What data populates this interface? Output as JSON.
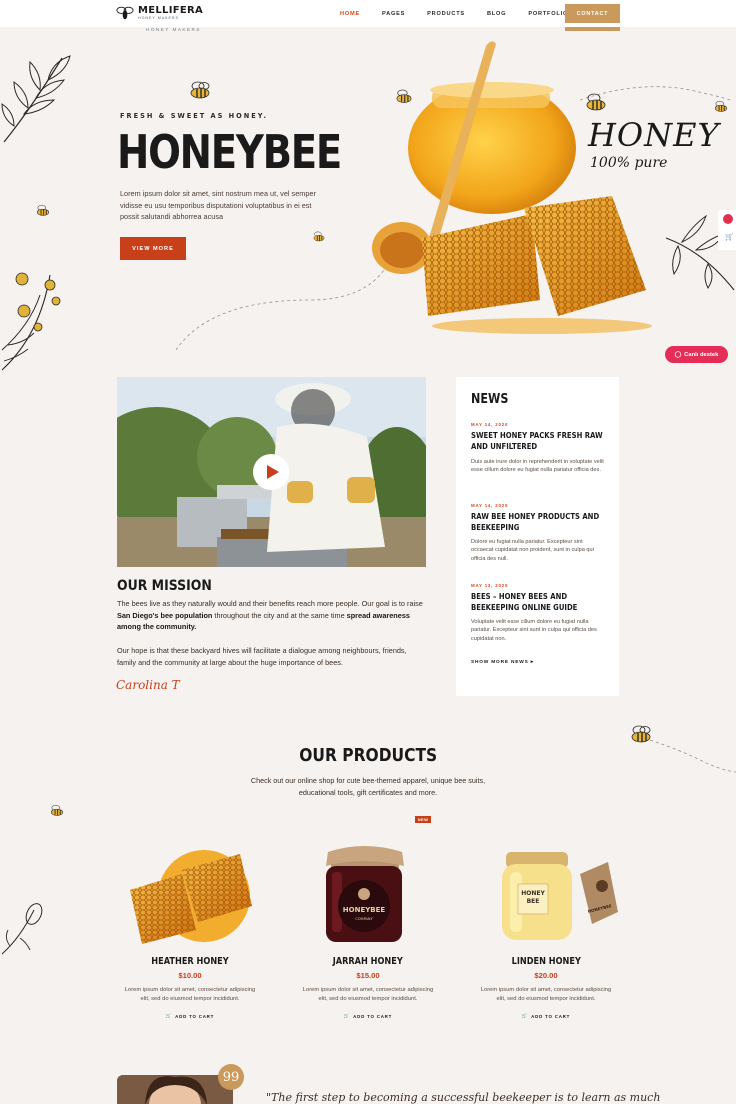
{
  "header": {
    "logo_name": "MELLIFERA",
    "logo_sub": "HONEY MAKERS",
    "ghost_tag": "HONEY MAKERS",
    "nav": [
      {
        "label": "HOME",
        "active": true
      },
      {
        "label": "PAGES",
        "active": false
      },
      {
        "label": "PRODUCTS",
        "active": false
      },
      {
        "label": "BLOG",
        "active": false
      },
      {
        "label": "PORTFOLIO",
        "active": false
      }
    ],
    "contact_label": "CONTACT"
  },
  "hero": {
    "kicker": "FRESH & SWEET AS HONEY.",
    "title": "HONEYBEE",
    "description": "Lorem ipsum dolor sit amet, sint nostrum mea ut, vel semper vidisse eu usu temporibus disputationi voluptatibus in ei est possit salutandi abhorrea acusa",
    "button_label": "VIEW MORE",
    "script_title": "HONEY",
    "script_sub": "100% pure"
  },
  "chat": {
    "label": "Canlı destek"
  },
  "mission": {
    "title": "OUR MISSION",
    "p1_a": "The bees live as they naturally would and their benefits reach more people. Our goal is to raise ",
    "p1_b": "San Diego's bee population",
    "p1_c": " throughout the city and at the same time ",
    "p1_d": "spread awareness among the community.",
    "p2": "Our hope is that these backyard hives will facilitate a dialogue among neighbours, friends, family and the community at large about the huge importance of bees.",
    "signature": "Carolina T"
  },
  "news": {
    "title": "NEWS",
    "items": [
      {
        "date": "MAY 14, 2020",
        "headline": "SWEET HONEY PACKS FRESH RAW AND UNFILTERED",
        "body": "Duis aute irure dolor in reprehenderit in voluptate velit esse cillum dolore eu fugiat nulla pariatur officia des."
      },
      {
        "date": "MAY 14, 2020",
        "headline": "RAW BEE HONEY PRODUCTS AND BEEKEEPING",
        "body": "Dolore eu fugiat nulla pariatur. Excepteur sint occaecat cupidatat non proident, sunt in culpa qui officia des null."
      },
      {
        "date": "MAY 13, 2020",
        "headline": "BEES – HONEY BEES AND BEEKEEPING ONLINE GUIDE",
        "body": "Voluptate velit esse cillum dolore eu fugiat nulla pariatur. Excepteur sint sunt in culpa qui officia des cupidatat non."
      }
    ],
    "more_label": "SHOW MORE NEWS"
  },
  "products": {
    "title": "OUR PRODUCTS",
    "subtitle": "Check out our online shop for cute bee-themed apparel, unique bee suits, educational tools, gift certificates and more.",
    "new_badge": "NEW",
    "jar_label_1": "HONEYBEE",
    "jar_label_2": "COMPANY",
    "jar_label_3": "HONEY",
    "jar_label_4": "BEE",
    "jar_tag": "HONEYBEE",
    "items": [
      {
        "name": "HEATHER HONEY",
        "price": "$10.00",
        "desc": "Lorem ipsum dolor sit amet, consectetur adipiscing elit, sed do eiusmod tempor incididunt.",
        "cart": "ADD TO CART"
      },
      {
        "name": "JARRAH HONEY",
        "price": "$15.00",
        "desc": "Lorem ipsum dolor sit amet, consectetur adipiscing elit, sed do eiusmod tempor incididunt.",
        "cart": "ADD TO CART"
      },
      {
        "name": "LINDEN HONEY",
        "price": "$20.00",
        "desc": "Lorem ipsum dolor sit amet, consectetur adipiscing elit, sed do eiusmod tempor incididunt.",
        "cart": "ADD TO CART"
      }
    ]
  },
  "testimonial": {
    "quote_mark": "99",
    "quote": "\"The first step to becoming a successful beekeeper is to learn as much"
  },
  "colors": {
    "accent": "#c8401a",
    "gold": "#c99a5b",
    "background": "#f6f2ef",
    "chat": "#e42e58"
  }
}
